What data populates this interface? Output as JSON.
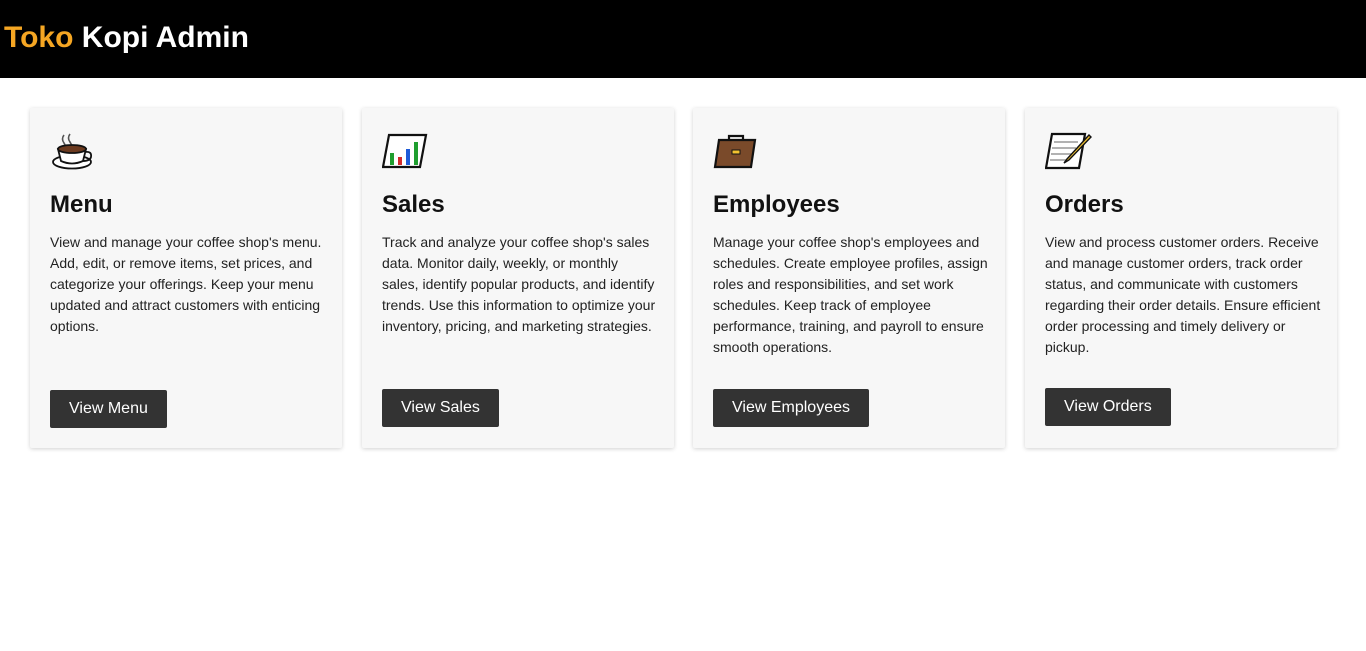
{
  "header": {
    "brand_accent": "Toko",
    "brand_rest": " Kopi Admin",
    "accent_color": "#f5a623"
  },
  "cards": [
    {
      "icon": "coffee-cup-icon",
      "title": "Menu",
      "description": "View and manage your coffee shop's menu. Add, edit, or remove items, set prices, and categorize your offerings. Keep your menu updated and attract customers with enticing options.",
      "button": "View Menu"
    },
    {
      "icon": "bar-chart-icon",
      "title": "Sales",
      "description": "Track and analyze your coffee shop's sales data. Monitor daily, weekly, or monthly sales, identify popular products, and identify trends. Use this information to optimize your inventory, pricing, and marketing strategies.",
      "button": "View Sales"
    },
    {
      "icon": "briefcase-icon",
      "title": "Employees",
      "description": "Manage your coffee shop's employees and schedules. Create employee profiles, assign roles and responsibilities, and set work schedules. Keep track of employee performance, training, and payroll to ensure smooth operations.",
      "button": "View Employees"
    },
    {
      "icon": "memo-icon",
      "title": "Orders",
      "description": "View and process customer orders. Receive and manage customer orders, track order status, and communicate with customers regarding their order details. Ensure efficient order processing and timely delivery or pickup.",
      "button": "View Orders"
    }
  ]
}
